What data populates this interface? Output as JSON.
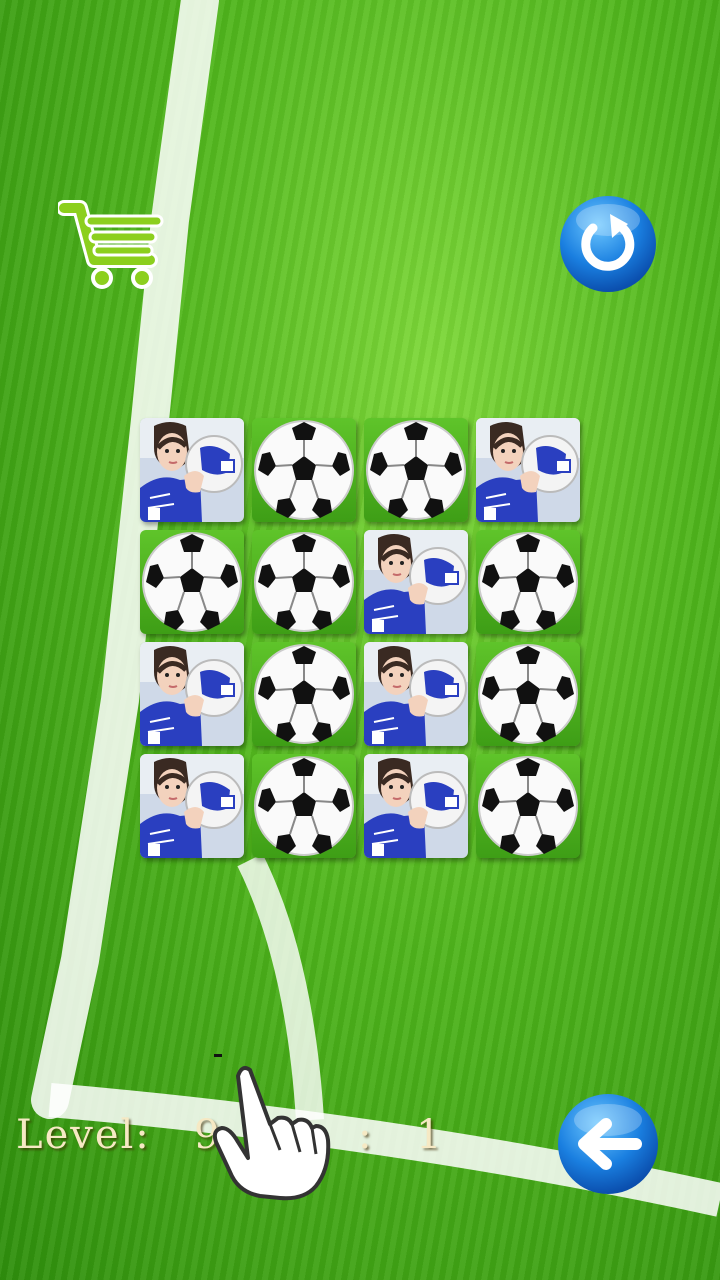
{
  "hud": {
    "level_label": "Level:",
    "level_value": "9",
    "separator": ":",
    "count": "1"
  },
  "icons": {
    "cart": "shopping-cart-icon",
    "refresh": "refresh-icon",
    "back": "back-arrow-icon",
    "hand": "pointing-hand-icon"
  },
  "board": {
    "rows": 4,
    "cols": 4,
    "tiles": [
      "player",
      "ball",
      "ball",
      "player",
      "ball",
      "ball",
      "player",
      "ball",
      "player",
      "ball",
      "player",
      "ball",
      "player",
      "ball",
      "player",
      "ball"
    ]
  },
  "colors": {
    "cart_green": "#8ccf1e",
    "button_blue": "#1a7fe0",
    "jersey_blue": "#2a3fc0"
  }
}
